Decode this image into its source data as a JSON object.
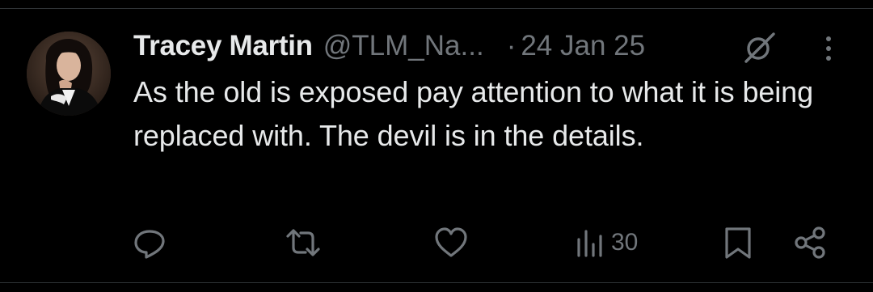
{
  "tweet": {
    "display_name": "Tracey Martin",
    "handle": "@TLM_Na...",
    "separator": "·",
    "date": "24 Jan 25",
    "text": "As the old is exposed pay attention to what it is being replaced with. The devil is in the details."
  },
  "actions": {
    "reply": {
      "icon": "reply-icon"
    },
    "retweet": {
      "icon": "retweet-icon"
    },
    "like": {
      "icon": "heart-icon"
    },
    "views": {
      "icon": "views-bar-chart-icon",
      "count": "30"
    },
    "bookmark": {
      "icon": "bookmark-icon"
    },
    "share": {
      "icon": "share-icon"
    }
  },
  "header_icons": {
    "grok": "grok-icon",
    "more": "more-vertical-icon"
  },
  "colors": {
    "background": "#000000",
    "primary_text": "#e7e9ea",
    "secondary_text": "#71767b",
    "divider": "#2f3336"
  }
}
